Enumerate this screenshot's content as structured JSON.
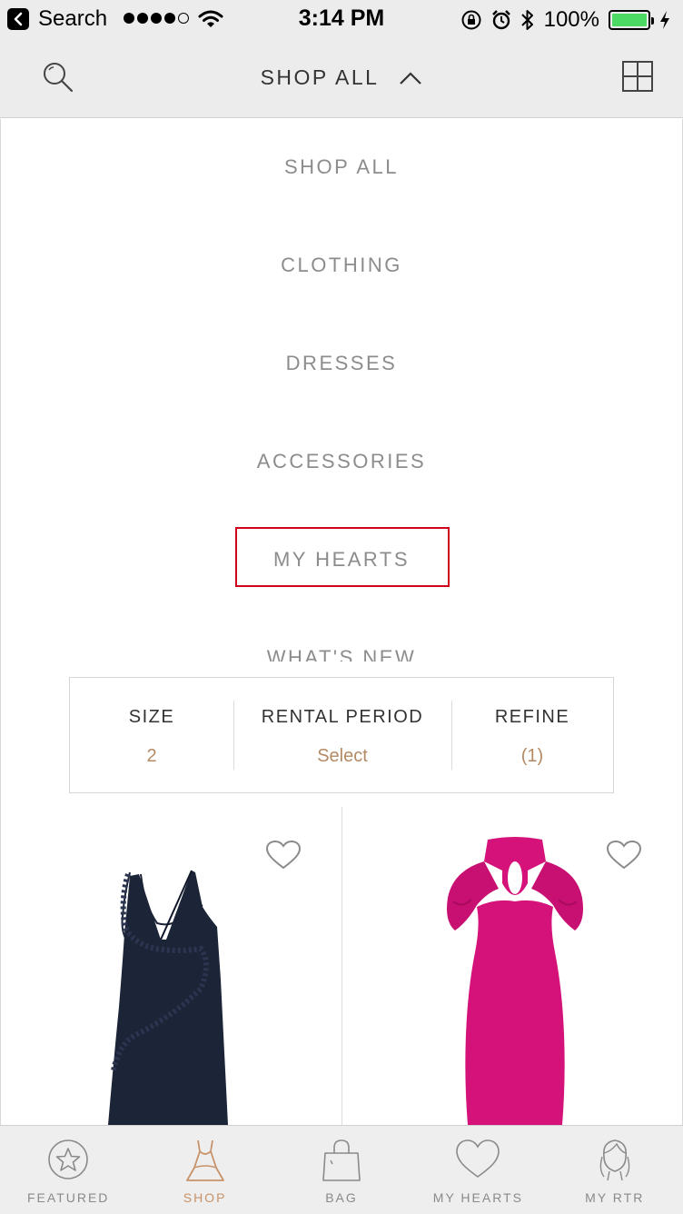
{
  "status_bar": {
    "back_label": "Search",
    "time": "3:14 PM",
    "battery": "100%"
  },
  "header": {
    "title": "SHOP ALL"
  },
  "menu": {
    "items": [
      {
        "label": "SHOP ALL"
      },
      {
        "label": "CLOTHING"
      },
      {
        "label": "DRESSES"
      },
      {
        "label": "ACCESSORIES"
      },
      {
        "label": "MY HEARTS"
      },
      {
        "label": "WHAT'S NEW"
      }
    ]
  },
  "filters": {
    "size": {
      "label": "SIZE",
      "value": "2"
    },
    "rental_period": {
      "label": "RENTAL PERIOD",
      "value": "Select"
    },
    "refine": {
      "label": "REFINE",
      "value": "(1)"
    }
  },
  "products": [
    {
      "icon": "navy-ruffle-slip-dress",
      "color": "#1c2437"
    },
    {
      "icon": "magenta-halter-dress",
      "color": "#d4127a"
    }
  ],
  "tabbar": {
    "tabs": [
      {
        "label": "FEATURED",
        "icon": "star-icon"
      },
      {
        "label": "SHOP",
        "icon": "dress-icon"
      },
      {
        "label": "BAG",
        "icon": "bag-icon"
      },
      {
        "label": "MY HEARTS",
        "icon": "heart-icon"
      },
      {
        "label": "MY RTR",
        "icon": "profile-icon"
      }
    ],
    "active_index": 1
  },
  "colors": {
    "accent": "#c8926a",
    "highlight_box": "#d0021b",
    "battery": "#4cd964"
  }
}
